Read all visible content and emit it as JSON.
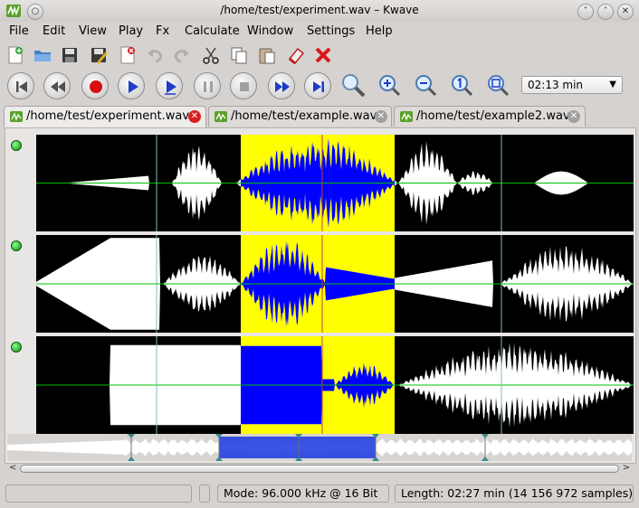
{
  "window": {
    "title": "/home/test/experiment.wav – Kwave",
    "app_icon": "kwave-icon"
  },
  "menu": [
    "File",
    "Edit",
    "View",
    "Play",
    "Fx",
    "Calculate",
    "Window",
    "Settings",
    "Help"
  ],
  "toolbar_file": [
    "new-file-icon",
    "open-file-icon",
    "save-icon",
    "save-as-icon",
    "close-file-icon",
    "undo-icon",
    "redo-icon",
    "cut-icon",
    "copy-icon",
    "paste-icon",
    "erase-icon",
    "delete-icon"
  ],
  "transport": [
    "rewind-to-start-button",
    "rewind-button",
    "record-button",
    "play-button",
    "loop-button",
    "pause-button",
    "stop-button",
    "forward-button",
    "forward-to-end-button"
  ],
  "zoom_tools": [
    "zoom-selection-icon",
    "zoom-in-icon",
    "zoom-out-icon",
    "zoom-normal-icon",
    "zoom-all-icon"
  ],
  "zoom": {
    "value": "02:13 min"
  },
  "tabs": [
    {
      "label": "/home/test/experiment.wav",
      "active": true
    },
    {
      "label": "/home/test/example.wav",
      "active": false
    },
    {
      "label": "/home/test/example2.wav",
      "active": false
    }
  ],
  "colors": {
    "selection": "#ffff00",
    "waveform": "#ffffff",
    "selected_waveform": "#0000ff",
    "background": "#000000",
    "zero_line": "#00c000",
    "marker": "#7fbfbf",
    "label_marker": "#c04040"
  },
  "status": {
    "mode": "Mode: 96.000 kHz @ 16 Bit",
    "length": "Length: 02:27 min (14 156 972 samples)"
  }
}
